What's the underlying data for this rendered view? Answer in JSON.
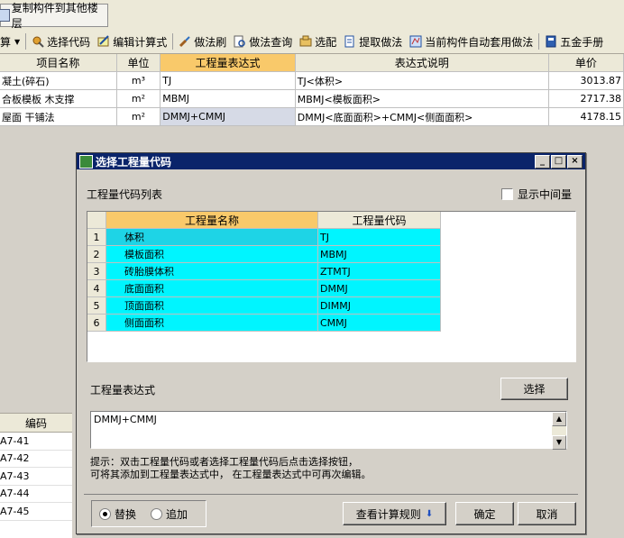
{
  "top": {
    "copy_label": "复制构件到其他楼层"
  },
  "toolbar": [
    {
      "label": "算",
      "icon": "dropdown-icon"
    },
    {
      "label": "选择代码",
      "icon": "select-code-icon"
    },
    {
      "label": "编辑计算式",
      "icon": "edit-formula-icon"
    },
    {
      "label": "做法刷",
      "icon": "brush-icon"
    },
    {
      "label": "做法查询",
      "icon": "query-icon"
    },
    {
      "label": "选配",
      "icon": "match-icon"
    },
    {
      "label": "提取做法",
      "icon": "extract-icon"
    },
    {
      "label": "当前构件自动套用做法",
      "icon": "auto-apply-icon"
    },
    {
      "label": "五金手册",
      "icon": "manual-icon"
    }
  ],
  "grid": {
    "headers": [
      "项目名称",
      "单位",
      "工程量表达式",
      "表达式说明",
      "单价"
    ],
    "rows": [
      [
        "凝土(碎石)",
        "m³",
        "TJ",
        "TJ<体积>",
        "3013.87"
      ],
      [
        "合板模板 木支撑",
        "m²",
        "MBMJ",
        "MBMJ<模板面积>",
        "2717.38"
      ],
      [
        "屋面 干铺法",
        "m²",
        "DMMJ+CMMJ",
        "DMMJ<底面面积>+CMMJ<侧面面积>",
        "4178.15"
      ]
    ]
  },
  "left_panel": {
    "header": "编码",
    "rows": [
      "A7-41",
      "A7-42",
      "A7-43",
      "A7-44",
      "A7-45"
    ]
  },
  "dialog": {
    "title": "选择工程量代码",
    "list_label": "工程量代码列表",
    "show_intermediate": "显示中间量",
    "columns": [
      "工程量名称",
      "工程量代码"
    ],
    "items": [
      {
        "num": "1",
        "name": "体积",
        "code": "TJ"
      },
      {
        "num": "2",
        "name": "模板面积",
        "code": "MBMJ"
      },
      {
        "num": "3",
        "name": "砖胎膜体积",
        "code": "ZTMTJ"
      },
      {
        "num": "4",
        "name": "底面面积",
        "code": "DMMJ"
      },
      {
        "num": "5",
        "name": "顶面面积",
        "code": "DIMMJ"
      },
      {
        "num": "6",
        "name": "侧面面积",
        "code": "CMMJ"
      }
    ],
    "expr_label": "工程量表达式",
    "select_btn": "选择",
    "expr_value": "DMMJ+CMMJ",
    "hint_line1": "提示：双击工程量代码或者选择工程量代码后点击选择按钮，",
    "hint_line2": "可将其添加到工程量表达式中， 在工程量表达式中可再次编辑。",
    "radio_replace": "替换",
    "radio_append": "追加",
    "view_rules": "查看计算规则",
    "ok": "确定",
    "cancel": "取消"
  }
}
